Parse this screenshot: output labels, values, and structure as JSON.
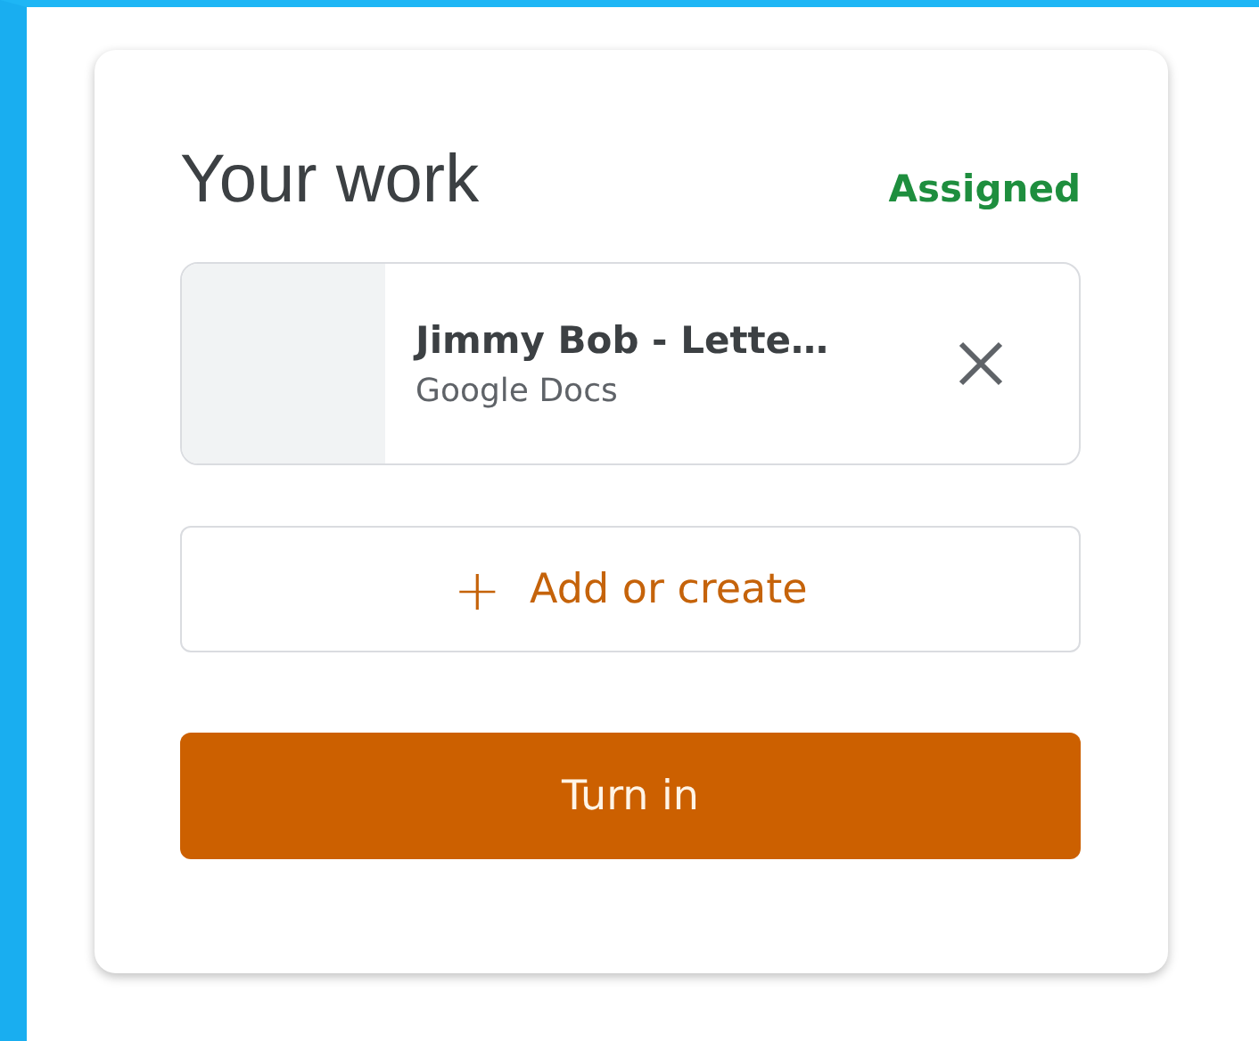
{
  "card": {
    "title": "Your work",
    "status": "Assigned",
    "attachments": [
      {
        "title": "Jimmy Bob - Lette…",
        "type": "Google Docs"
      }
    ],
    "add_button": {
      "icon": "+",
      "label": "Add or create"
    },
    "submit_button": "Turn in"
  }
}
